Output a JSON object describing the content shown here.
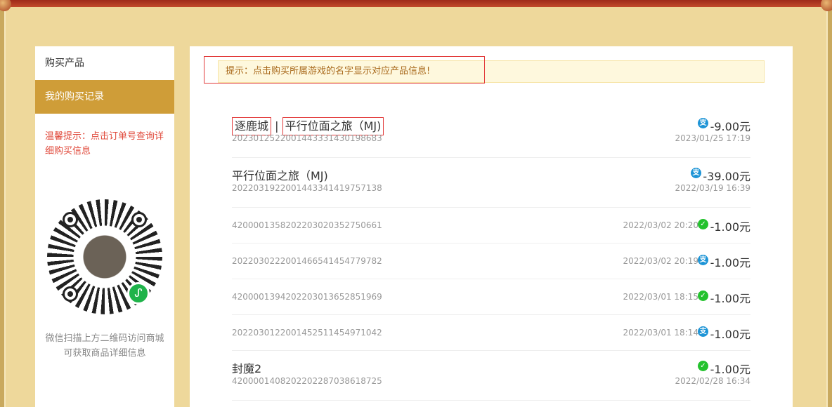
{
  "sidebar": {
    "items": [
      {
        "label": "购买产品"
      },
      {
        "label": "我的购买记录"
      }
    ],
    "tip": "温馨提示：点击订单号查询详细购买信息",
    "qr_caption": "微信扫描上方二维码访问商城可获取商品详细信息"
  },
  "notice": {
    "text": "提示：点击购买所属游戏的名字显示对应产品信息!"
  },
  "records": [
    {
      "game": "逐鹿城",
      "separator": "|",
      "product": "平行位面之旅（MJ)",
      "order": "2023012522001443331430198683",
      "amount": "-9.00元",
      "time": "2023/01/25 17:19",
      "pay": "alipay",
      "pay_glyph": "支"
    },
    {
      "product": "平行位面之旅（MJ)",
      "order": "2022031922001443341419757138",
      "amount": "-39.00元",
      "time": "2022/03/19 16:39",
      "pay": "alipay",
      "pay_glyph": "支"
    },
    {
      "order": "4200001358202203020352750661",
      "amount": "-1.00元",
      "time": "2022/03/02 20:20",
      "pay": "wechat",
      "pay_glyph": "✓"
    },
    {
      "order": "2022030222001466541454779782",
      "amount": "-1.00元",
      "time": "2022/03/02 20:19",
      "pay": "alipay",
      "pay_glyph": "支"
    },
    {
      "order": "4200001394202203013652851969",
      "amount": "-1.00元",
      "time": "2022/03/01 18:15",
      "pay": "wechat",
      "pay_glyph": "✓"
    },
    {
      "order": "2022030122001452511454971042",
      "amount": "-1.00元",
      "time": "2022/03/01 18:14",
      "pay": "alipay",
      "pay_glyph": "支"
    },
    {
      "product": "封魔2",
      "order": "4200001408202202287038618725",
      "amount": "-1.00元",
      "time": "2022/02/28 16:34",
      "pay": "wechat",
      "pay_glyph": "✓"
    }
  ],
  "colors": {
    "accent": "#cf9d38",
    "alert": "#e0483a",
    "alipay": "#1d94d6",
    "wechat": "#24c22e"
  }
}
